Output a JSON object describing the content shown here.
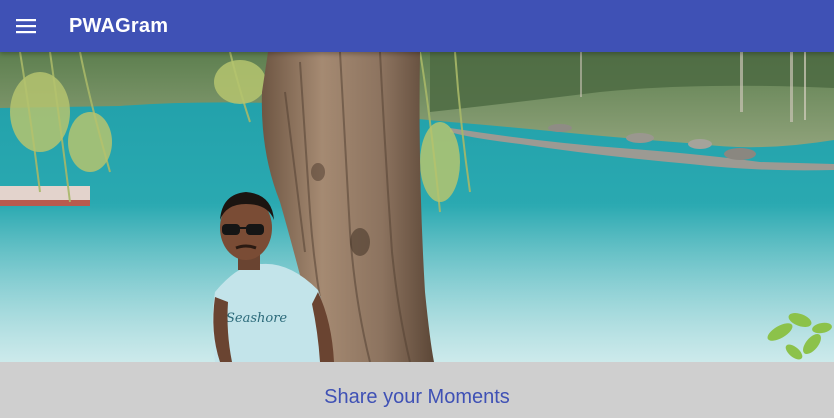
{
  "header": {
    "title": "PWAGram",
    "menu_icon": "hamburger-menu-icon",
    "background_color": "#3f51b5"
  },
  "hero": {
    "image_content": "man in sunglasses and 'Seashore' t-shirt standing beside a tree trunk in front of a turquoise lake",
    "shirt_text": "Seashore"
  },
  "share": {
    "label": "Share your Moments",
    "label_color": "#3f51b5",
    "background_color": "#cfcfcf"
  }
}
